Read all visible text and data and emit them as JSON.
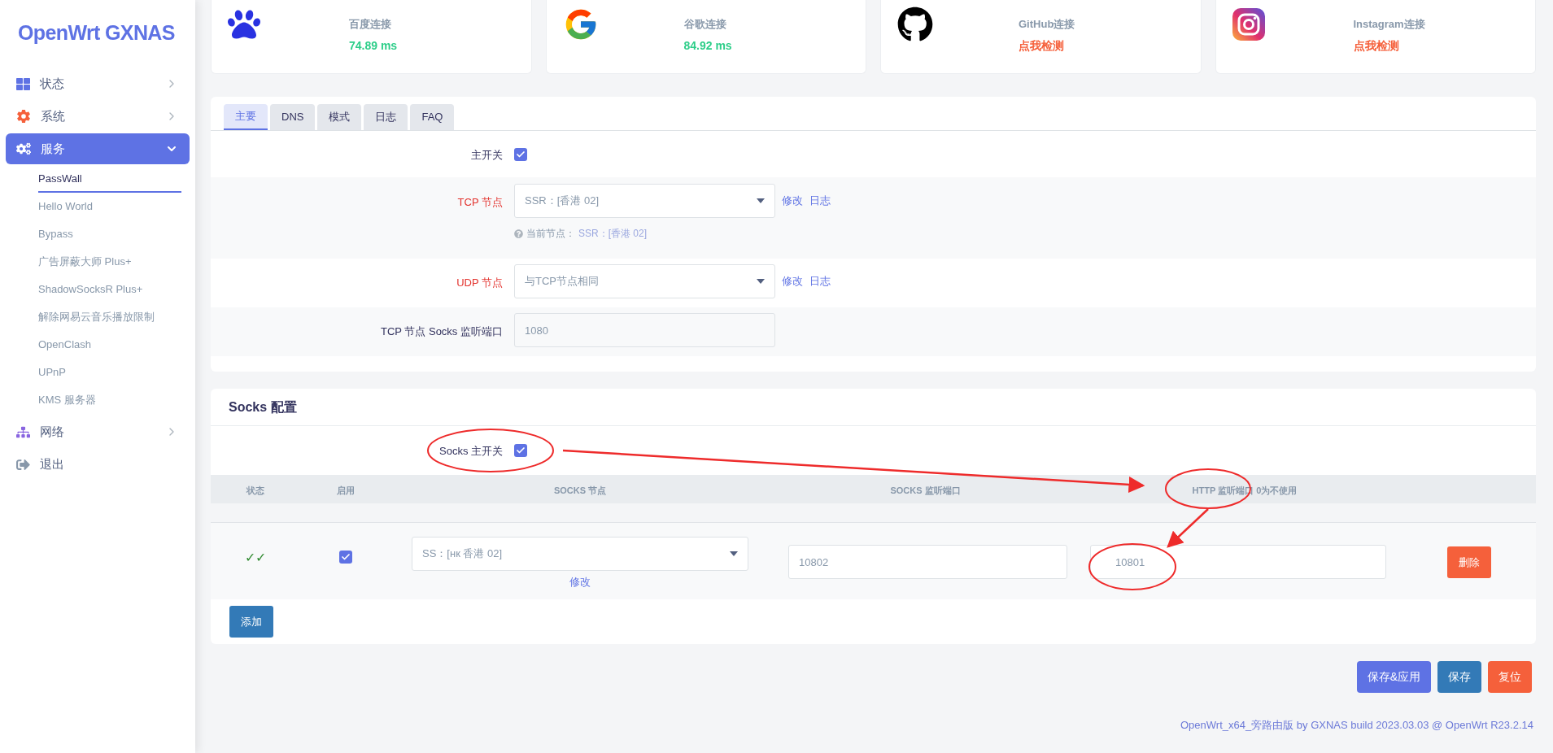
{
  "sidebar": {
    "logo": "OpenWrt GXNAS",
    "items": [
      {
        "label": "状态",
        "selected": false,
        "expanded": false
      },
      {
        "label": "系统",
        "selected": false,
        "expanded": false
      },
      {
        "label": "服务",
        "selected": true,
        "expanded": true,
        "children": [
          {
            "label": "PassWall",
            "selected": true
          },
          {
            "label": "Hello World",
            "selected": false
          },
          {
            "label": "Bypass",
            "selected": false
          },
          {
            "label": "广告屏蔽大师 Plus+",
            "selected": false
          },
          {
            "label": "ShadowSocksR Plus+",
            "selected": false
          },
          {
            "label": "解除网易云音乐播放限制",
            "selected": false
          },
          {
            "label": "OpenClash",
            "selected": false
          },
          {
            "label": "UPnP",
            "selected": false
          },
          {
            "label": "KMS 服务器",
            "selected": false
          }
        ]
      },
      {
        "label": "网络",
        "selected": false,
        "expanded": false
      },
      {
        "label": "退出",
        "selected": false
      }
    ]
  },
  "status_cards": [
    {
      "label": "百度连接",
      "value": "74.89 ms",
      "kind": "latency"
    },
    {
      "label": "谷歌连接",
      "value": "84.92 ms",
      "kind": "latency"
    },
    {
      "label": "GitHub连接",
      "value": "点我检测",
      "kind": "action"
    },
    {
      "label": "Instagram连接",
      "value": "点我检测",
      "kind": "action"
    }
  ],
  "main_panel": {
    "tabs": [
      {
        "label": "主要",
        "selected": true
      },
      {
        "label": "DNS",
        "selected": false
      },
      {
        "label": "模式",
        "selected": false
      },
      {
        "label": "日志",
        "selected": false
      },
      {
        "label": "FAQ",
        "selected": false
      }
    ],
    "fields": [
      {
        "kind": "checkbox",
        "label": "主开关",
        "emphasized": false,
        "checked": true
      },
      {
        "kind": "select",
        "label": "TCP 节点",
        "emphasized": true,
        "value": "SSR：[香港 02]",
        "links": [
          "修改",
          "日志"
        ],
        "hint_label": "当前节点：",
        "hint_value": "SSR：[香港 02]"
      },
      {
        "kind": "select",
        "label": "UDP 节点",
        "emphasized": true,
        "value": "与TCP节点相同",
        "links": [
          "修改",
          "日志"
        ]
      },
      {
        "kind": "input",
        "label": "TCP 节点 Socks 监听端口",
        "emphasized": false,
        "value": "1080"
      }
    ]
  },
  "socks_panel": {
    "title": "Socks 配置",
    "switch": {
      "label": "Socks 主开关",
      "checked": true
    },
    "columns": [
      "状态",
      "启用",
      "SOCKS 节点",
      "SOCKS 监听端口",
      "HTTP 监听端口 0为不使用"
    ],
    "rows": [
      {
        "status": "✓✓",
        "enabled": true,
        "node": "SS：[нк 香港 02]",
        "node_link": "修改",
        "socks_port": "10802",
        "http_port": "10801",
        "delete": "删除"
      }
    ],
    "add_button": "添加"
  },
  "actions": [
    {
      "label": "保存&应用",
      "kind": "apply"
    },
    {
      "label": "保存",
      "kind": "save"
    },
    {
      "label": "复位",
      "kind": "reset"
    }
  ],
  "footer": "OpenWrt_x64_旁路由版 by GXNAS build 2023.03.03 @ OpenWrt R23.2.14"
}
